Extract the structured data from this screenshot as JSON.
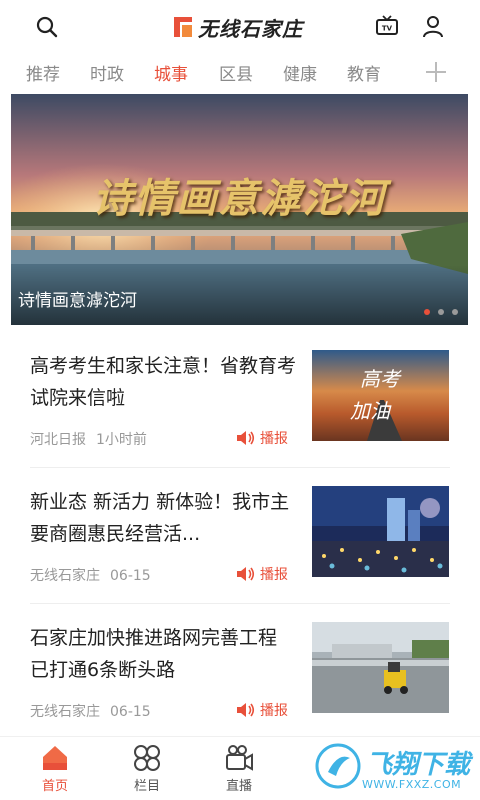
{
  "header": {
    "app_name": "无线石家庄",
    "icons": [
      "search-icon",
      "tv-icon",
      "user-icon"
    ]
  },
  "tabs": [
    {
      "label": "推荐",
      "active": false
    },
    {
      "label": "时政",
      "active": false
    },
    {
      "label": "城事",
      "active": true
    },
    {
      "label": "区县",
      "active": false
    },
    {
      "label": "健康",
      "active": false
    },
    {
      "label": "教育",
      "active": false
    }
  ],
  "banner": {
    "overlay_title": "诗情画意滹沱河",
    "caption": "诗情画意滹沱河",
    "slide_count": 3,
    "active_slide": 1
  },
  "articles": [
    {
      "title": "高考考生和家长注意！省教育考试院来信啦",
      "source": "河北日报",
      "time": "1小时前",
      "action": "播报",
      "thumb_text_1": "高考",
      "thumb_text_2": "加油"
    },
    {
      "title": "新业态 新活力 新体验！我市主要商圈惠民经营活...",
      "source": "无线石家庄",
      "time": "06-15",
      "action": "播报"
    },
    {
      "title": "石家庄加快推进路网完善工程 已打通6条断头路",
      "source": "无线石家庄",
      "time": "06-15",
      "action": "播报"
    }
  ],
  "bottom_nav": [
    {
      "label": "首页",
      "active": true
    },
    {
      "label": "栏目",
      "active": false
    },
    {
      "label": "直播",
      "active": false
    }
  ],
  "watermark": {
    "brand": "飞翔下载",
    "url": "WWW.FXXZ.COM"
  },
  "colors": {
    "accent": "#e8503a",
    "text": "#222222",
    "muted": "#999999"
  }
}
